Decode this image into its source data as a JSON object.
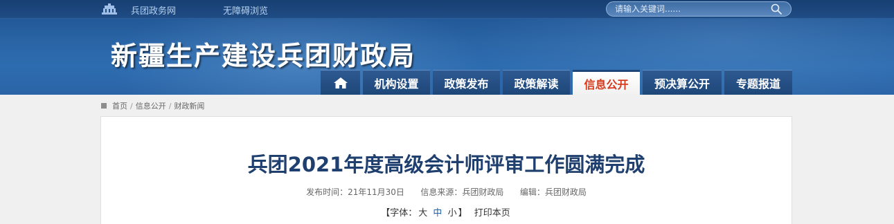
{
  "topbar": {
    "gov_link": "兵团政务网",
    "accessibility_link": "无障碍浏览",
    "search_placeholder": "请输入关键词......"
  },
  "site": {
    "title": "新疆生产建设兵团财政局"
  },
  "nav": {
    "items": [
      {
        "label": "机构设置"
      },
      {
        "label": "政策发布"
      },
      {
        "label": "政策解读"
      },
      {
        "label": "信息公开"
      },
      {
        "label": "预决算公开"
      },
      {
        "label": "专题报道"
      }
    ],
    "active_index": 3
  },
  "breadcrumb": {
    "items": [
      "首页",
      "信息公开",
      "财政新闻"
    ],
    "separator": "/"
  },
  "article": {
    "title": "兵团2021年度高级会计师评审工作圆满完成",
    "publish_time": "发布时间：21年11月30日",
    "source": "信息来源：兵团财政局",
    "editor": "编辑：兵团财政局"
  },
  "tools": {
    "open": "【字体：",
    "large": "大",
    "medium": "中",
    "small": "小",
    "close": "】",
    "print": "打印本页"
  },
  "colors": {
    "header_blue": "#2a65a6",
    "title_blue": "#1f3f6e",
    "active_tab_red": "#d53a1d"
  },
  "icons": [
    "gov-building-icon",
    "search-icon",
    "home-icon",
    "breadcrumb-square-icon"
  ]
}
